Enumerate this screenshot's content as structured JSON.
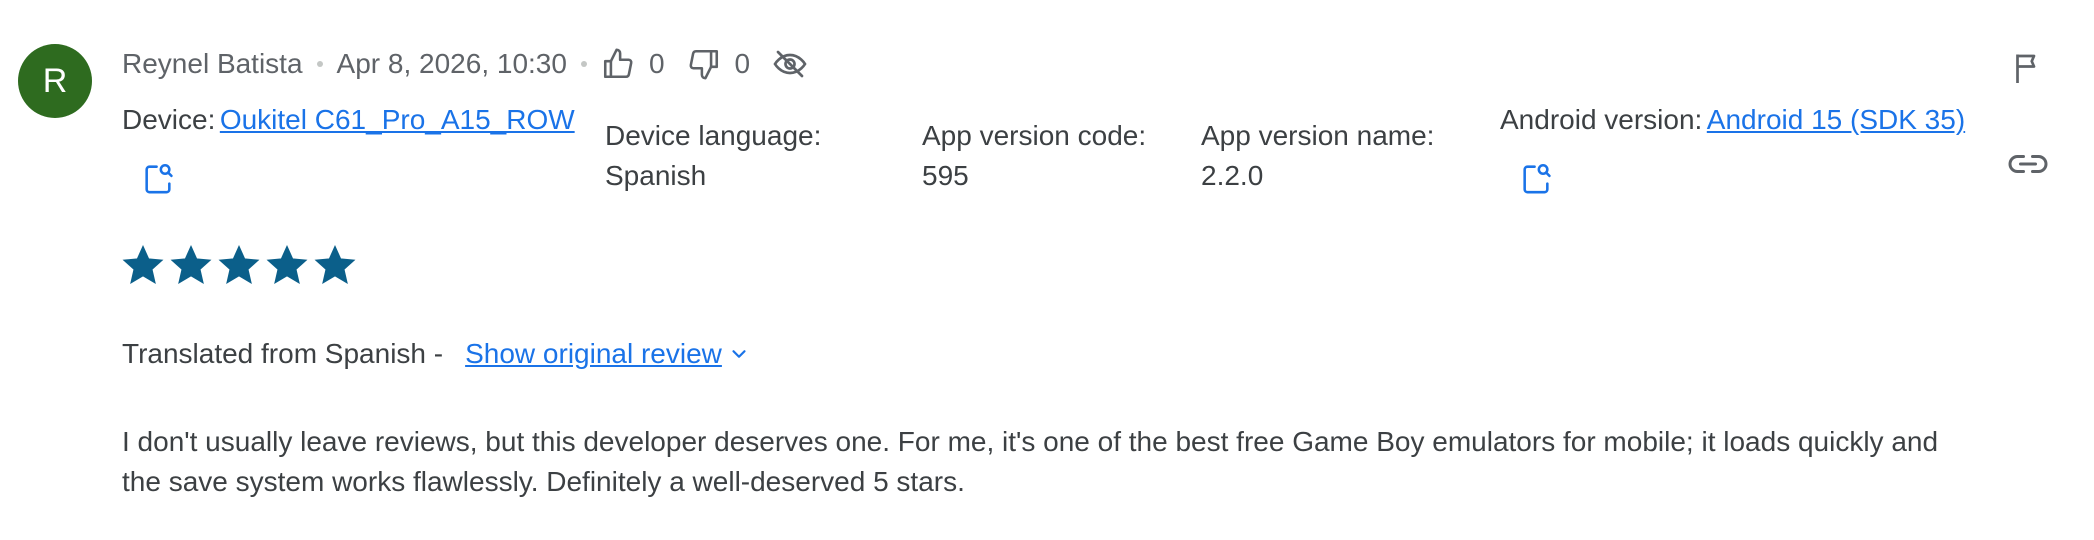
{
  "reviewer": {
    "avatar_letter": "R",
    "name": "Reynel Batista",
    "date": "Apr 8, 2026, 10:30"
  },
  "votes": {
    "up_count": "0",
    "down_count": "0"
  },
  "device": {
    "device_label": "Device:",
    "device_value": "Oukitel C61_Pro_A15_ROW",
    "language_label": "Device language:",
    "language_value": "Spanish",
    "version_code_label": "App version code:",
    "version_code_value": "595",
    "version_name_label": "App version name:",
    "version_name_value": "2.2.0",
    "android_label": "Android version:",
    "android_value": "Android 15 (SDK 35)"
  },
  "rating": {
    "stars": 5,
    "max": 5
  },
  "translation": {
    "note": "Translated from Spanish -",
    "show_original": "Show original review"
  },
  "review_text": "I don't usually leave reviews, but this developer deserves one. For me, it's one of the best free Game Boy emulators for mobile; it loads quickly and the save system works flawlessly. Definitely a well-deserved 5 stars.",
  "colors": {
    "avatar_bg": "#2e6b1f",
    "link": "#1a73e8",
    "star": "#0b5f8a",
    "icon": "#5f6368"
  },
  "icons": [
    "thumb-up-icon",
    "thumb-down-icon",
    "eye-off-icon",
    "flag-icon",
    "link-icon",
    "device-search-icon",
    "chevron-down-icon",
    "star-icon"
  ]
}
